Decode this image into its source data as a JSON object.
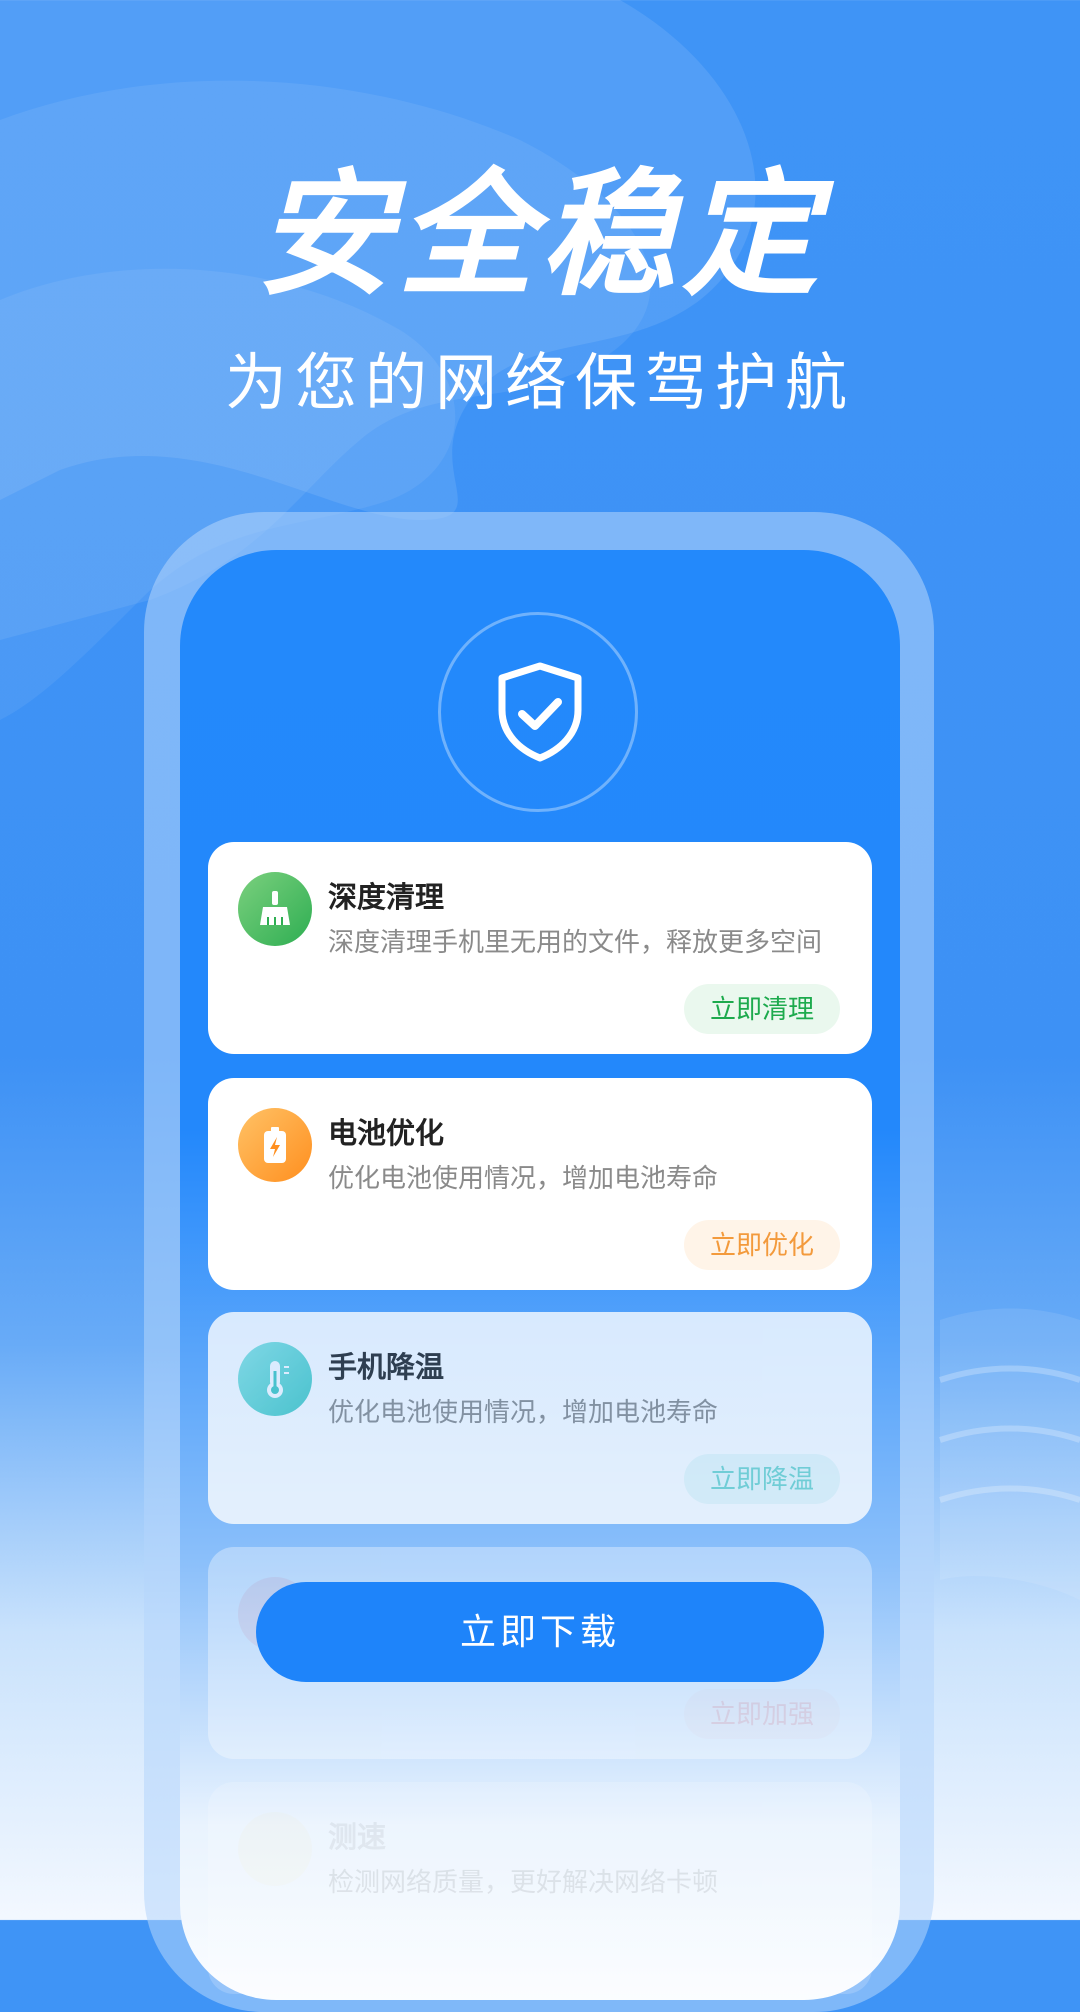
{
  "headline": {
    "title": "安全稳定",
    "subtitle": "为您的网络保驾护航"
  },
  "shield": {
    "icon": "shield-check-icon"
  },
  "cards": [
    {
      "title": "深度清理",
      "desc": "深度清理手机里无用的文件，释放更多空间",
      "button": "立即清理",
      "icon": "broom-icon",
      "color": "#2eae52"
    },
    {
      "title": "电池优化",
      "desc": "优化电池使用情况，增加电池寿命",
      "button": "立即优化",
      "icon": "battery-icon",
      "color": "#ff8f1f"
    },
    {
      "title": "手机降温",
      "desc": "优化电池使用情况，增加电池寿命",
      "button": "立即降温",
      "icon": "thermometer-icon",
      "color": "#43c9c2"
    },
    {
      "title": "",
      "desc": "",
      "button": "立即加强",
      "icon": "signal-icon",
      "color": "#ff8080"
    },
    {
      "title": "测速",
      "desc": "检测网络质量，更好解决网络卡顿",
      "button": "",
      "icon": "speed-icon",
      "color": "#f6c04a"
    }
  ],
  "download_button": "立即下载",
  "colors": {
    "background": "#3f94f6",
    "phone": "#2389fb",
    "button": "#1e84fa"
  }
}
